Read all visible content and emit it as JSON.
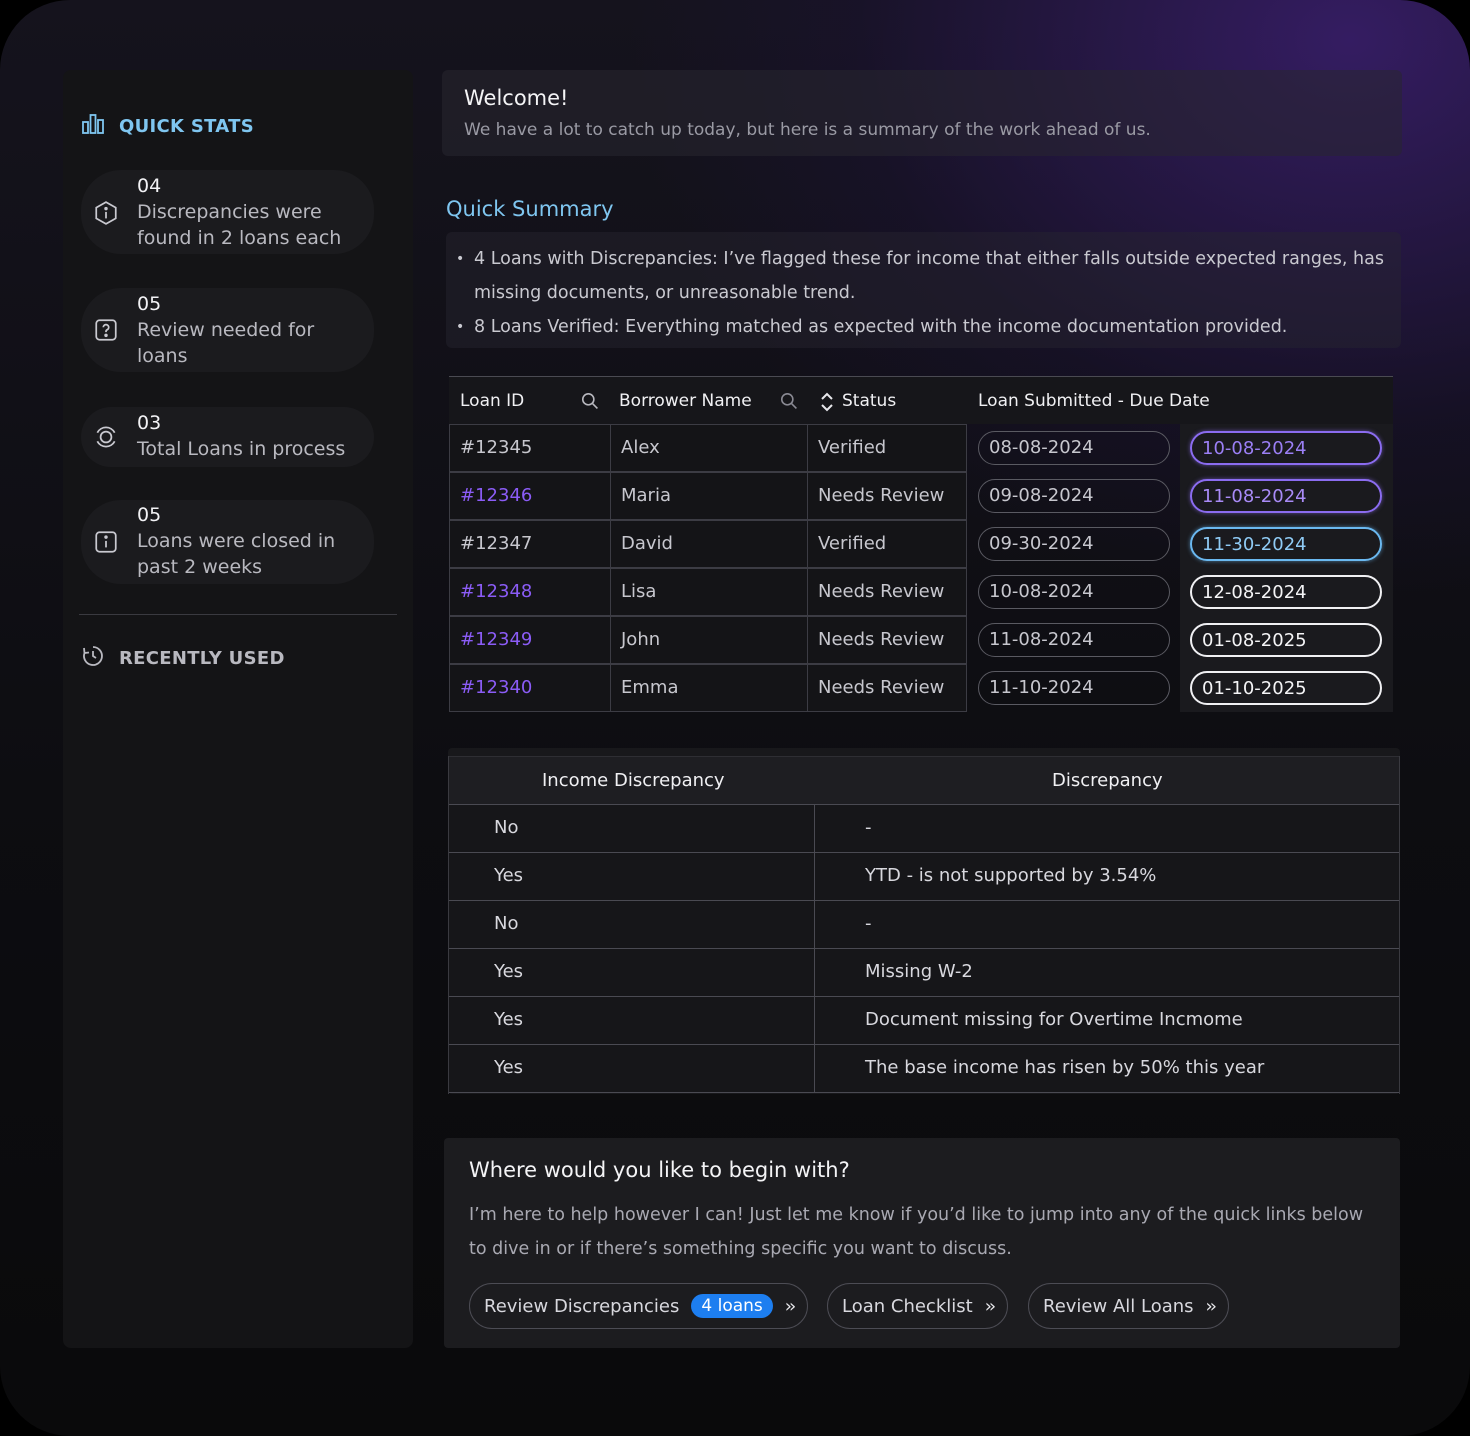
{
  "sidebar": {
    "quick_stats_label": "QUICK STATS",
    "stats": [
      {
        "number": "04",
        "text": "Discrepancies were found in 2 loans each",
        "icon": "hexagon-info-icon"
      },
      {
        "number": "05",
        "text": "Review needed for loans",
        "icon": "question-square-icon"
      },
      {
        "number": "03",
        "text": "Total Loans in process",
        "icon": "target-ring-icon"
      },
      {
        "number": "05",
        "text": "Loans were closed in past 2 weeks",
        "icon": "info-square-icon"
      }
    ],
    "recently_used_label": "RECENTLY USED"
  },
  "welcome": {
    "title": "Welcome!",
    "subtitle": "We have a lot to catch up today, but here is a summary of the work ahead of us."
  },
  "quick_summary": {
    "title": "Quick Summary",
    "bullets": [
      "4 Loans with Discrepancies: I’ve flagged these for income that either falls outside expected ranges, has missing documents, or unreasonable trend.",
      "8 Loans Verified: Everything matched as expected with the income documentation provided."
    ]
  },
  "loan_table": {
    "headers": {
      "loan_id": "Loan ID",
      "borrower": "Borrower Name",
      "status": "Status",
      "dates": "Loan Submitted - Due Date"
    },
    "rows": [
      {
        "id": "#12345",
        "name": "Alex",
        "status": "Verified",
        "submitted": "08-08-2024",
        "due": "10-08-2024"
      },
      {
        "id": "#12346",
        "name": "Maria",
        "status": "Needs Review",
        "submitted": "09-08-2024",
        "due": "11-08-2024"
      },
      {
        "id": "#12347",
        "name": "David",
        "status": "Verified",
        "submitted": "09-30-2024",
        "due": "11-30-2024"
      },
      {
        "id": "#12348",
        "name": "Lisa",
        "status": "Needs Review",
        "submitted": "10-08-2024",
        "due": "12-08-2024"
      },
      {
        "id": "#12349",
        "name": "John",
        "status": "Needs Review",
        "submitted": "11-08-2024",
        "due": "01-08-2025"
      },
      {
        "id": "#12340",
        "name": "Emma",
        "status": "Needs Review",
        "submitted": "11-10-2024",
        "due": "01-10-2025"
      }
    ]
  },
  "discrepancy_table": {
    "headers": {
      "income": "Income Discrepancy",
      "discrepancy": "Discrepancy"
    },
    "rows": [
      {
        "income": "No",
        "discrepancy": "-"
      },
      {
        "income": "Yes",
        "discrepancy": "YTD - is not supported by 3.54%"
      },
      {
        "income": "No",
        "discrepancy": "-"
      },
      {
        "income": "Yes",
        "discrepancy": "Missing W-2"
      },
      {
        "income": "Yes",
        "discrepancy": "Document missing for Overtime Incmome"
      },
      {
        "income": "Yes",
        "discrepancy": "The base income has risen by 50% this year"
      }
    ]
  },
  "begin": {
    "title": "Where would you like to begin with?",
    "description": "I’m here to help however I can! Just let me know if you’d like to jump into any of the quick links below to dive in or if there’s something specific you want to discuss.",
    "buttons": {
      "review_discrepancies": "Review Discrepancies",
      "review_badge": "4 loans",
      "loan_checklist": "Loan Checklist",
      "review_all": "Review All Loans"
    }
  },
  "colors": {
    "accent_blue": "#7fc6f0",
    "accent_purple": "#8b5cf6",
    "badge_blue": "#1d7ef0",
    "due_purple": "#8b6cf0",
    "due_blue": "#6ab8f0"
  }
}
